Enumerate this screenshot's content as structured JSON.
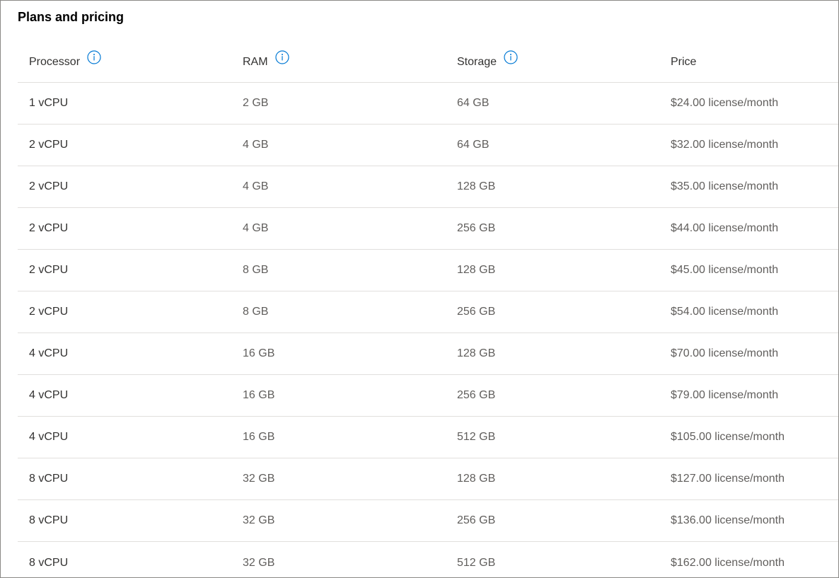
{
  "page": {
    "title": "Plans and pricing"
  },
  "table": {
    "headers": {
      "processor": "Processor",
      "ram": "RAM",
      "storage": "Storage",
      "price": "Price"
    },
    "info_icons": [
      "info-icon",
      "info-icon",
      "info-icon"
    ],
    "rows": [
      {
        "processor": "1 vCPU",
        "ram": "2 GB",
        "storage": "64 GB",
        "price": "$24.00 license/month"
      },
      {
        "processor": "2 vCPU",
        "ram": "4 GB",
        "storage": "64 GB",
        "price": "$32.00 license/month"
      },
      {
        "processor": "2 vCPU",
        "ram": "4 GB",
        "storage": "128 GB",
        "price": "$35.00 license/month"
      },
      {
        "processor": "2 vCPU",
        "ram": "4 GB",
        "storage": "256 GB",
        "price": "$44.00 license/month"
      },
      {
        "processor": "2 vCPU",
        "ram": "8 GB",
        "storage": "128 GB",
        "price": "$45.00 license/month"
      },
      {
        "processor": "2 vCPU",
        "ram": "8 GB",
        "storage": "256 GB",
        "price": "$54.00 license/month"
      },
      {
        "processor": "4 vCPU",
        "ram": "16 GB",
        "storage": "128 GB",
        "price": "$70.00 license/month"
      },
      {
        "processor": "4 vCPU",
        "ram": "16 GB",
        "storage": "256 GB",
        "price": "$79.00 license/month"
      },
      {
        "processor": "4 vCPU",
        "ram": "16 GB",
        "storage": "512 GB",
        "price": "$105.00 license/month"
      },
      {
        "processor": "8 vCPU",
        "ram": "32 GB",
        "storage": "128 GB",
        "price": "$127.00 license/month"
      },
      {
        "processor": "8 vCPU",
        "ram": "32 GB",
        "storage": "256 GB",
        "price": "$136.00 license/month"
      },
      {
        "processor": "8 vCPU",
        "ram": "32 GB",
        "storage": "512 GB",
        "price": "$162.00 license/month"
      }
    ]
  },
  "colors": {
    "info_icon": "#0078d4",
    "divider": "#e1dfdd",
    "border": "#8a8886"
  }
}
